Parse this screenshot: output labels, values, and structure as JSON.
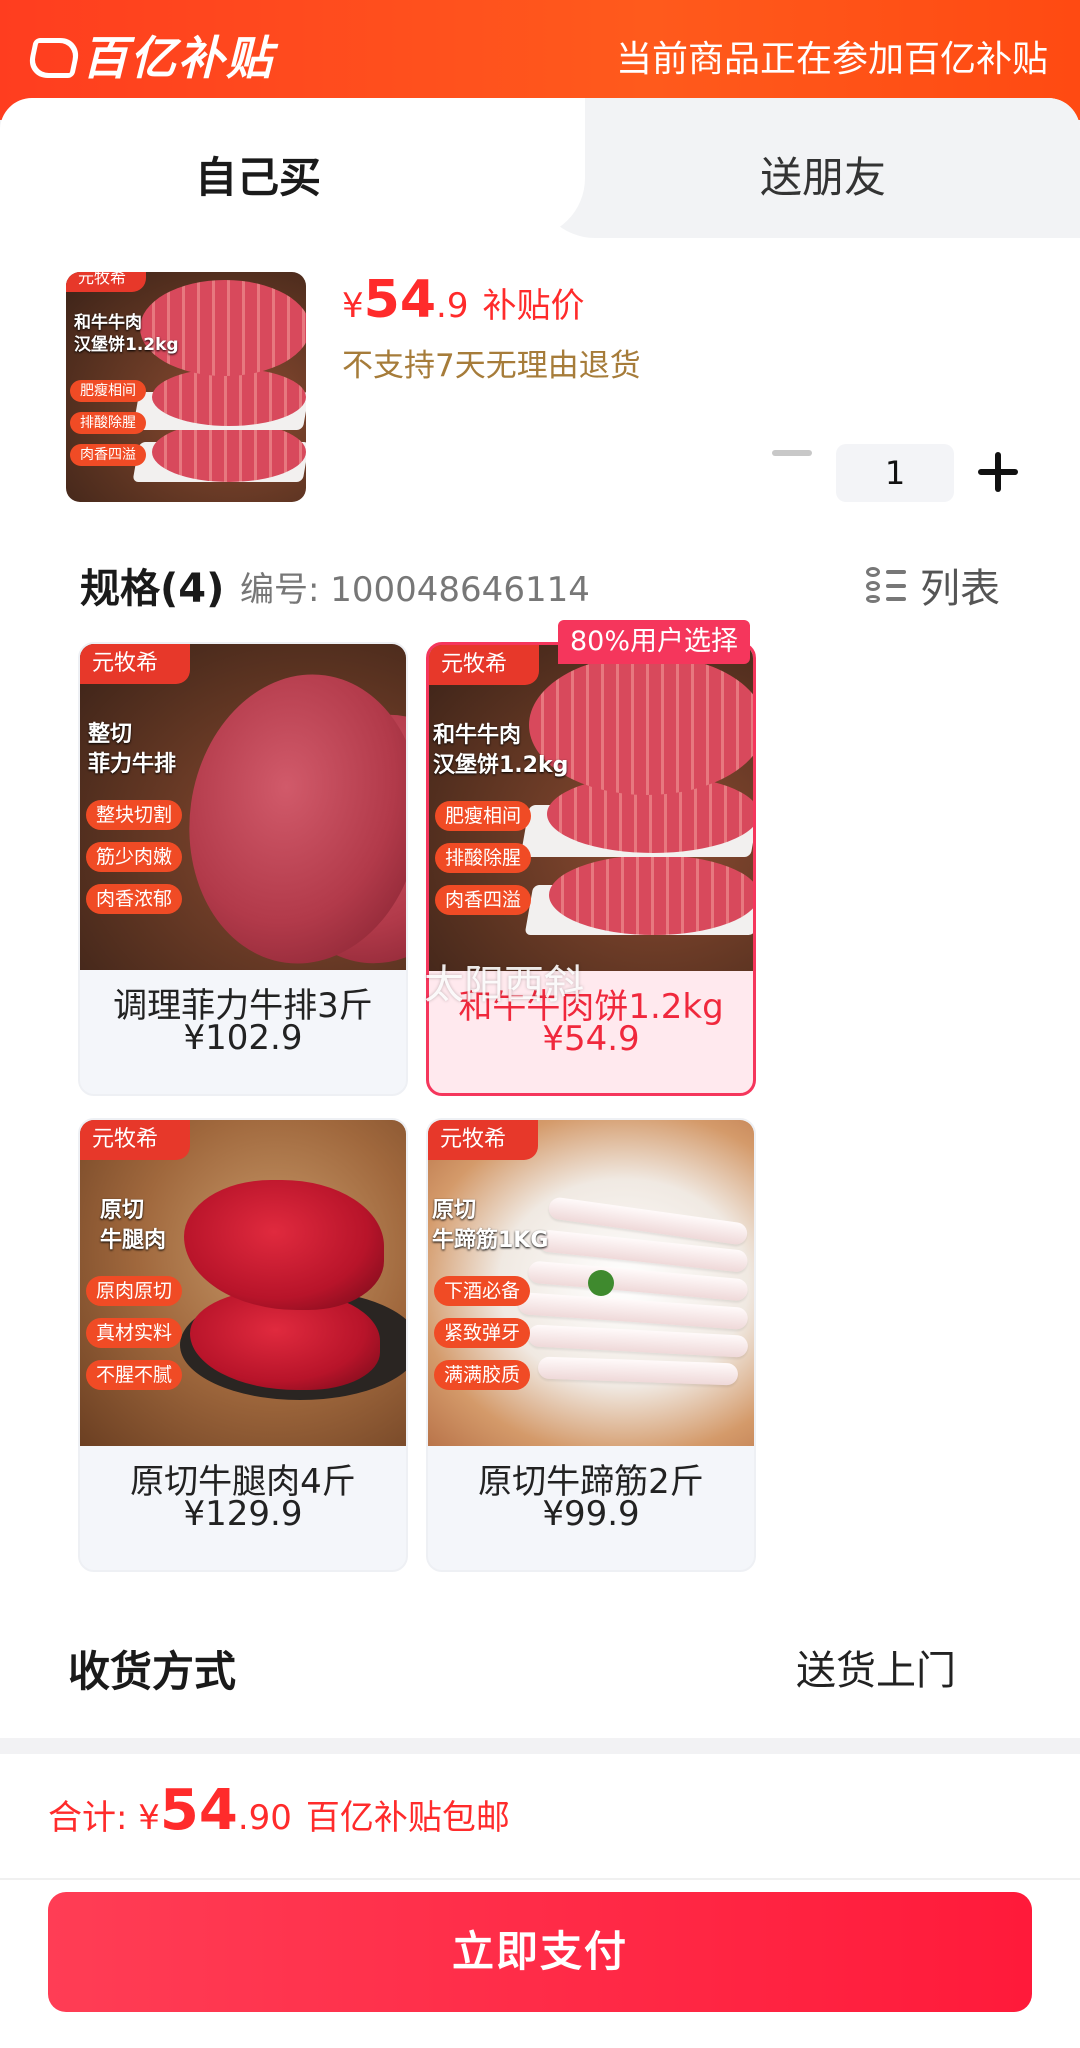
{
  "header": {
    "brand_label": "百亿补贴",
    "notice": "当前商品正在参加百亿补贴"
  },
  "tabs": [
    {
      "label": "自己买",
      "active": true
    },
    {
      "label": "送朋友",
      "active": false
    }
  ],
  "product": {
    "currency": "¥",
    "price_int": "54",
    "price_dec": ".9",
    "price_tag": "补贴价",
    "return_policy": "不支持7天无理由退货",
    "quantity": "1"
  },
  "specs": {
    "title": "规格(4)",
    "code": "编号: 100048646114",
    "view_toggle": "列表",
    "popular_badge": "80%用户选择",
    "items": [
      {
        "name": "调理菲力牛排3斤",
        "price": "¥102.9",
        "selected": false,
        "img_brand": "元牧希",
        "img_title": [
          "整切",
          "菲力牛排"
        ],
        "img_chips": [
          "整块切割",
          "筋少肉嫩",
          "肉香浓郁"
        ]
      },
      {
        "name": "和牛牛肉饼1.2kg",
        "price": "¥54.9",
        "selected": true,
        "img_brand": "元牧希",
        "img_title": [
          "和牛牛肉",
          "汉堡饼1.2kg"
        ],
        "img_chips": [
          "肥瘦相间",
          "排酸除腥",
          "肉香四溢"
        ]
      },
      {
        "name": "原切牛腿肉4斤",
        "price": "¥129.9",
        "selected": false,
        "img_brand": "元牧希",
        "img_title": [
          "原切",
          "牛腿肉"
        ],
        "img_chips": [
          "原肉原切",
          "真材实料",
          "不腥不腻"
        ]
      },
      {
        "name": "原切牛蹄筋2斤",
        "price": "¥99.9",
        "selected": false,
        "img_brand": "元牧希",
        "img_title": [
          "原切",
          "牛蹄筋1KG"
        ],
        "img_chips": [
          "下酒必备",
          "紧致弹牙",
          "满满胶质"
        ]
      }
    ]
  },
  "thumb": {
    "brand": "元牧希",
    "title": [
      "和牛牛肉",
      "汉堡饼1.2kg"
    ],
    "chips": [
      "肥瘦相间",
      "排酸除腥",
      "肉香四溢"
    ]
  },
  "watermark": "太阳西斜",
  "delivery": {
    "label": "收货方式",
    "value": "送货上门"
  },
  "footer": {
    "total_label": "合计: ",
    "currency": "¥",
    "total_int": "54",
    "total_dec": ".90",
    "shipping_note": "百亿补贴包邮",
    "pay_button": "立即支付"
  },
  "colors": {
    "brand_orange": "#ff4a1a",
    "price_red": "#ff2b2b",
    "selected_border": "#f5365c",
    "gold_text": "#a67c3a"
  }
}
